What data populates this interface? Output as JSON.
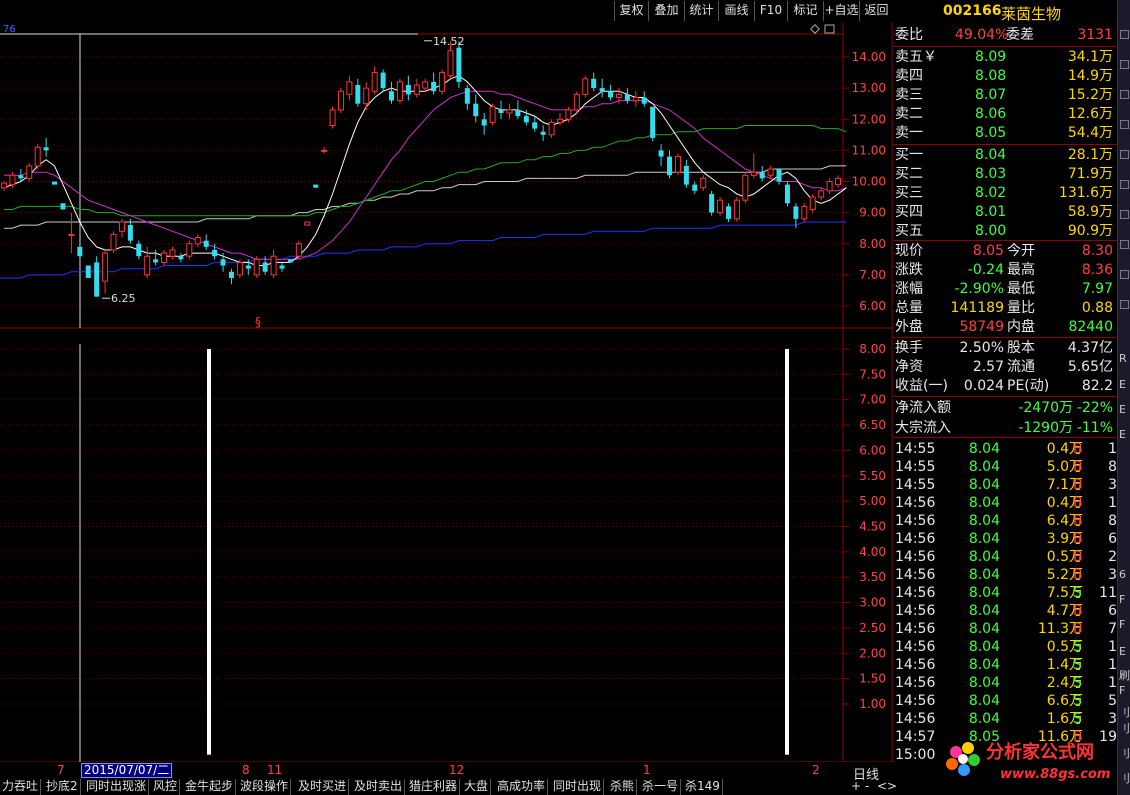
{
  "toolbar": {
    "buttons": [
      "复权",
      "叠加",
      "统计",
      "画线",
      "F10",
      "标记",
      "+自选",
      "返回"
    ]
  },
  "stock": {
    "code": "002166",
    "name": "莱茵生物"
  },
  "order_ratio": {
    "label1": "委比",
    "value1": "49.04%",
    "label2": "委差",
    "value2": "3131"
  },
  "asks": [
    {
      "label": "卖五￥",
      "price": "8.09",
      "volume": "34.1万"
    },
    {
      "label": "卖四",
      "price": "8.08",
      "volume": "14.9万"
    },
    {
      "label": "卖三",
      "price": "8.07",
      "volume": "15.2万"
    },
    {
      "label": "卖二",
      "price": "8.06",
      "volume": "12.6万"
    },
    {
      "label": "卖一",
      "price": "8.05",
      "volume": "54.4万"
    }
  ],
  "bids": [
    {
      "label": "买一",
      "price": "8.04",
      "volume": "28.1万"
    },
    {
      "label": "买二",
      "price": "8.03",
      "volume": "71.9万"
    },
    {
      "label": "买三",
      "price": "8.02",
      "volume": "131.6万"
    },
    {
      "label": "买四",
      "price": "8.01",
      "volume": "58.9万"
    },
    {
      "label": "买五",
      "price": "8.00",
      "volume": "90.9万"
    }
  ],
  "quote": [
    {
      "l1": "现价",
      "v1": "8.05",
      "c1": "#ff4040",
      "l2": "今开",
      "v2": "8.30",
      "c2": "#ff4040"
    },
    {
      "l1": "涨跌",
      "v1": "-0.24",
      "c1": "#40ff40",
      "l2": "最高",
      "v2": "8.36",
      "c2": "#ff4040"
    },
    {
      "l1": "涨幅",
      "v1": "-2.90%",
      "c1": "#40ff40",
      "l2": "最低",
      "v2": "7.97",
      "c2": "#40ff40"
    },
    {
      "l1": "总量",
      "v1": "141189",
      "c1": "#ffd700",
      "l2": "量比",
      "v2": "0.88",
      "c2": "#ffd700"
    },
    {
      "l1": "外盘",
      "v1": "58749",
      "c1": "#ff4040",
      "l2": "内盘",
      "v2": "82440",
      "c2": "#40ff40"
    }
  ],
  "fundamentals": [
    {
      "l1": "换手",
      "v1": "2.50%",
      "l2": "股本",
      "v2": "4.37亿"
    },
    {
      "l1": "净资",
      "v1": "2.57",
      "l2": "流通",
      "v2": "5.65亿"
    },
    {
      "l1": "收益(一)",
      "v1": "0.024",
      "l2": "PE(动)",
      "v2": "82.2"
    }
  ],
  "flows": [
    {
      "label": "净流入额",
      "value": "-2470万",
      "pct": "-22%"
    },
    {
      "label": "大宗流入",
      "value": "-1290万",
      "pct": "-11%"
    }
  ],
  "ticks": [
    {
      "time": "14:55",
      "price": "8.04",
      "vol": "0.4万",
      "side": "B",
      "n": "1"
    },
    {
      "time": "14:55",
      "price": "8.04",
      "vol": "5.0万",
      "side": "B",
      "n": "8"
    },
    {
      "time": "14:55",
      "price": "8.04",
      "vol": "7.1万",
      "side": "B",
      "n": "3"
    },
    {
      "time": "14:56",
      "price": "8.04",
      "vol": "0.4万",
      "side": "B",
      "n": "1"
    },
    {
      "time": "14:56",
      "price": "8.04",
      "vol": "6.4万",
      "side": "B",
      "n": "8"
    },
    {
      "time": "14:56",
      "price": "8.04",
      "vol": "3.9万",
      "side": "B",
      "n": "6"
    },
    {
      "time": "14:56",
      "price": "8.04",
      "vol": "0.5万",
      "side": "B",
      "n": "2"
    },
    {
      "time": "14:56",
      "price": "8.04",
      "vol": "5.2万",
      "side": "B",
      "n": "3"
    },
    {
      "time": "14:56",
      "price": "8.04",
      "vol": "7.5万",
      "side": "S",
      "n": "11"
    },
    {
      "time": "14:56",
      "price": "8.04",
      "vol": "4.7万",
      "side": "B",
      "n": "6"
    },
    {
      "time": "14:56",
      "price": "8.04",
      "vol": "11.3万",
      "side": "B",
      "n": "7"
    },
    {
      "time": "14:56",
      "price": "8.04",
      "vol": "0.5万",
      "side": "S",
      "n": "1"
    },
    {
      "time": "14:56",
      "price": "8.04",
      "vol": "1.4万",
      "side": "S",
      "n": "1"
    },
    {
      "time": "14:56",
      "price": "8.04",
      "vol": "2.4万",
      "side": "S",
      "n": "1"
    },
    {
      "time": "14:56",
      "price": "8.04",
      "vol": "6.6万",
      "side": "S",
      "n": "5"
    },
    {
      "time": "14:56",
      "price": "8.04",
      "vol": "1.6万",
      "side": "S",
      "n": "3"
    },
    {
      "time": "14:57",
      "price": "8.05",
      "vol": "11.6万",
      "side": "B",
      "n": "19"
    },
    {
      "time": "15:00",
      "price": "",
      "vol": "",
      "side": "",
      "n": ""
    }
  ],
  "bottom_tabs": [
    "力吞吐",
    "抄底2",
    "同时出现涨",
    "风控",
    "金牛起步",
    "波段操作",
    "及时买进",
    "及时卖出",
    "猎庄利器",
    "大盘",
    "高成功率",
    "同时出现",
    "杀熊",
    "杀一号",
    "杀149"
  ],
  "x_labels": [
    "7",
    "8",
    "11",
    "12",
    "1",
    "2"
  ],
  "selected_date": "2015/07/07/二",
  "period": "日线",
  "nav": [
    "+",
    "-",
    "<",
    ">"
  ],
  "corner_label": "76",
  "marker_symbol": "§",
  "watermark": {
    "title": "分析家公式网",
    "url": "www.88gs.com"
  },
  "side_strip_chars": [
    "R",
    "E",
    "E",
    "E",
    "6",
    "F",
    "F",
    "E",
    "刷",
    "F",
    "刂",
    "刂",
    "刂",
    "刂"
  ],
  "chart_data": {
    "type": "candlestick",
    "price_axis": {
      "ticks": [
        "14.00",
        "13.00",
        "12.00",
        "11.00",
        "10.00",
        "9.00",
        "8.00",
        "7.00",
        "6.00"
      ],
      "range": [
        5.6,
        14.8
      ]
    },
    "lower_axis": {
      "ticks": [
        "8.00",
        "7.50",
        "7.00",
        "6.50",
        "6.00",
        "5.50",
        "5.00",
        "4.50",
        "4.00",
        "3.50",
        "3.00",
        "2.50",
        "2.00",
        "1.50",
        "1.00"
      ],
      "range": [
        0.0,
        8.4
      ]
    },
    "annotations": [
      {
        "text": "14.52",
        "value": 14.52
      },
      {
        "text": "6.25",
        "value": 6.25
      }
    ],
    "candles": [
      [
        9.8,
        10.0,
        9.7,
        9.95
      ],
      [
        9.9,
        10.3,
        9.8,
        10.2
      ],
      [
        10.2,
        10.4,
        10.0,
        10.1
      ],
      [
        10.1,
        10.6,
        10.0,
        10.5
      ],
      [
        10.5,
        11.2,
        10.4,
        11.1
      ],
      [
        11.1,
        11.4,
        10.8,
        11.0
      ],
      [
        10.0,
        10.0,
        9.9,
        9.9
      ],
      [
        9.3,
        9.3,
        9.1,
        9.1
      ],
      [
        8.3,
        9.0,
        7.7,
        8.3
      ],
      [
        7.9,
        8.0,
        7.5,
        7.6
      ],
      [
        7.3,
        7.3,
        6.9,
        6.9
      ],
      [
        7.4,
        7.6,
        6.3,
        6.3
      ],
      [
        6.8,
        7.8,
        6.4,
        7.7
      ],
      [
        7.8,
        8.4,
        7.7,
        8.3
      ],
      [
        8.4,
        8.8,
        8.2,
        8.7
      ],
      [
        8.6,
        8.8,
        8.0,
        8.1
      ],
      [
        8.0,
        8.1,
        7.5,
        7.6
      ],
      [
        7.0,
        7.9,
        6.9,
        7.6
      ],
      [
        7.5,
        7.8,
        7.3,
        7.4
      ],
      [
        7.4,
        7.8,
        7.3,
        7.7
      ],
      [
        7.6,
        7.9,
        7.5,
        7.8
      ],
      [
        7.6,
        7.7,
        7.4,
        7.5
      ],
      [
        7.6,
        8.1,
        7.5,
        8.0
      ],
      [
        8.0,
        8.3,
        7.9,
        8.2
      ],
      [
        8.1,
        8.3,
        7.8,
        7.9
      ],
      [
        7.8,
        8.0,
        7.5,
        7.6
      ],
      [
        7.5,
        7.7,
        7.1,
        7.3
      ],
      [
        7.1,
        7.2,
        6.7,
        6.9
      ],
      [
        7.0,
        7.5,
        6.9,
        7.4
      ],
      [
        7.3,
        7.5,
        7.0,
        7.2
      ],
      [
        7.0,
        7.6,
        6.9,
        7.5
      ],
      [
        7.4,
        7.6,
        7.0,
        7.1
      ],
      [
        7.0,
        7.8,
        6.9,
        7.6
      ],
      [
        7.3,
        7.4,
        7.1,
        7.2
      ],
      [
        7.5,
        7.5,
        7.4,
        7.4
      ],
      [
        7.6,
        8.1,
        7.5,
        8.0
      ],
      [
        8.6,
        8.7,
        8.6,
        8.7
      ],
      [
        9.9,
        9.9,
        9.8,
        9.8
      ],
      [
        11.0,
        11.1,
        10.9,
        11.0
      ],
      [
        11.8,
        12.4,
        11.7,
        12.3
      ],
      [
        12.3,
        13.0,
        12.2,
        12.9
      ],
      [
        12.8,
        13.4,
        12.6,
        13.2
      ],
      [
        13.1,
        13.3,
        12.4,
        12.5
      ],
      [
        12.5,
        13.2,
        12.3,
        13.0
      ],
      [
        12.9,
        13.7,
        12.8,
        13.5
      ],
      [
        13.5,
        13.6,
        12.9,
        13.0
      ],
      [
        12.9,
        13.2,
        12.5,
        12.6
      ],
      [
        12.6,
        13.3,
        12.5,
        13.2
      ],
      [
        13.1,
        13.4,
        12.6,
        12.8
      ],
      [
        12.8,
        13.3,
        12.7,
        13.1
      ],
      [
        13.0,
        13.3,
        12.9,
        13.2
      ],
      [
        13.2,
        13.5,
        12.8,
        12.9
      ],
      [
        12.9,
        13.6,
        12.8,
        13.5
      ],
      [
        13.4,
        14.5,
        13.3,
        14.2
      ],
      [
        14.3,
        14.5,
        13.0,
        13.2
      ],
      [
        13.0,
        13.1,
        12.3,
        12.5
      ],
      [
        12.5,
        12.8,
        11.9,
        12.1
      ],
      [
        12.0,
        12.2,
        11.5,
        11.8
      ],
      [
        11.9,
        12.5,
        11.8,
        12.4
      ],
      [
        12.3,
        12.6,
        12.0,
        12.2
      ],
      [
        12.2,
        12.5,
        12.0,
        12.3
      ],
      [
        12.3,
        12.6,
        12.0,
        12.1
      ],
      [
        12.1,
        12.3,
        11.8,
        11.9
      ],
      [
        11.9,
        12.1,
        11.6,
        11.7
      ],
      [
        11.6,
        11.8,
        11.3,
        11.5
      ],
      [
        11.5,
        12.0,
        11.4,
        11.9
      ],
      [
        11.9,
        12.2,
        11.8,
        12.0
      ],
      [
        12.0,
        12.4,
        11.9,
        12.3
      ],
      [
        12.3,
        12.9,
        12.2,
        12.8
      ],
      [
        12.8,
        13.4,
        12.7,
        13.3
      ],
      [
        13.3,
        13.5,
        12.9,
        13.0
      ],
      [
        13.0,
        13.3,
        12.7,
        12.9
      ],
      [
        12.9,
        13.1,
        12.6,
        12.7
      ],
      [
        12.7,
        13.0,
        12.5,
        12.8
      ],
      [
        12.8,
        13.0,
        12.5,
        12.6
      ],
      [
        12.6,
        12.9,
        12.4,
        12.7
      ],
      [
        12.7,
        12.9,
        12.4,
        12.5
      ],
      [
        12.4,
        12.4,
        11.3,
        11.4
      ],
      [
        11.0,
        11.2,
        10.5,
        10.8
      ],
      [
        10.8,
        11.0,
        10.1,
        10.2
      ],
      [
        10.3,
        10.9,
        10.2,
        10.8
      ],
      [
        10.5,
        10.7,
        9.8,
        9.9
      ],
      [
        9.9,
        10.0,
        9.6,
        9.7
      ],
      [
        9.8,
        10.2,
        9.7,
        10.1
      ],
      [
        9.6,
        9.7,
        8.9,
        9.0
      ],
      [
        9.0,
        9.5,
        8.9,
        9.4
      ],
      [
        9.2,
        9.3,
        8.7,
        8.8
      ],
      [
        8.8,
        9.5,
        8.7,
        9.4
      ],
      [
        9.4,
        10.3,
        9.3,
        10.2
      ],
      [
        10.2,
        10.9,
        10.1,
        10.3
      ],
      [
        10.3,
        10.5,
        10.0,
        10.1
      ],
      [
        10.2,
        10.5,
        10.1,
        10.4
      ],
      [
        10.4,
        10.4,
        9.9,
        10.0
      ],
      [
        9.9,
        10.0,
        9.2,
        9.3
      ],
      [
        9.2,
        9.3,
        8.5,
        8.8
      ],
      [
        8.8,
        9.3,
        8.7,
        9.2
      ],
      [
        9.1,
        9.6,
        9.0,
        9.5
      ],
      [
        9.5,
        9.8,
        9.4,
        9.7
      ],
      [
        9.7,
        10.1,
        9.6,
        10.0
      ],
      [
        9.9,
        10.2,
        9.8,
        10.1
      ]
    ],
    "ma_white": [
      9.8,
      9.9,
      10.0,
      10.2,
      10.5,
      10.7,
      10.5,
      9.9,
      9.3,
      8.7,
      8.2,
      7.9,
      7.8,
      7.8,
      7.9,
      7.9,
      7.8,
      7.7,
      7.7,
      7.6,
      7.6,
      7.6,
      7.7,
      7.7,
      7.7,
      7.7,
      7.6,
      7.5,
      7.4,
      7.4,
      7.3,
      7.3,
      7.4,
      7.4,
      7.4,
      7.6,
      7.9,
      8.3,
      8.9,
      9.6,
      10.4,
      11.2,
      11.9,
      12.4,
      12.7,
      12.9,
      13.0,
      12.9,
      12.9,
      12.9,
      12.9,
      13.0,
      13.1,
      13.3,
      13.4,
      13.2,
      12.9,
      12.6,
      12.4,
      12.3,
      12.3,
      12.3,
      12.2,
      12.1,
      11.9,
      11.8,
      11.9,
      12.0,
      12.2,
      12.5,
      12.7,
      12.9,
      12.9,
      12.9,
      12.8,
      12.7,
      12.7,
      12.5,
      12.2,
      11.8,
      11.4,
      11.0,
      10.6,
      10.3,
      10.1,
      9.9,
      9.8,
      9.6,
      9.5,
      9.6,
      9.8,
      10.0,
      10.2,
      10.3,
      10.1,
      9.7,
      9.4,
      9.3,
      9.4,
      9.6,
      9.8
    ],
    "ma_magenta": [
      10.2,
      10.2,
      10.2,
      10.3,
      10.3,
      10.3,
      10.2,
      10.0,
      9.8,
      9.6,
      9.4,
      9.3,
      9.2,
      9.1,
      9.0,
      8.9,
      8.8,
      8.7,
      8.6,
      8.5,
      8.4,
      8.3,
      8.2,
      8.1,
      8.0,
      7.9,
      7.8,
      7.7,
      7.7,
      7.6,
      7.5,
      7.5,
      7.5,
      7.5,
      7.5,
      7.5,
      7.6,
      7.7,
      7.9,
      8.1,
      8.4,
      8.7,
      9.1,
      9.5,
      9.9,
      10.3,
      10.7,
      11.0,
      11.4,
      11.7,
      12.0,
      12.3,
      12.5,
      12.7,
      12.8,
      12.9,
      12.9,
      12.9,
      12.9,
      12.8,
      12.8,
      12.7,
      12.6,
      12.5,
      12.4,
      12.3,
      12.3,
      12.3,
      12.3,
      12.4,
      12.4,
      12.5,
      12.5,
      12.6,
      12.6,
      12.6,
      12.6,
      12.5,
      12.4,
      12.3,
      12.1,
      11.9,
      11.7,
      11.4,
      11.2,
      11.0,
      10.8,
      10.6,
      10.4,
      10.3,
      10.2,
      10.1,
      10.0,
      10.0,
      10.0,
      9.9,
      9.8,
      9.8,
      9.7,
      9.7,
      9.8
    ],
    "ma_green": [
      9.1,
      9.1,
      9.2,
      9.2,
      9.2,
      9.2,
      9.2,
      9.2,
      9.2,
      9.1,
      9.1,
      9.0,
      9.0,
      9.0,
      8.9,
      8.9,
      8.9,
      8.9,
      8.9,
      8.9,
      8.9,
      8.9,
      8.9,
      8.9,
      8.9,
      8.9,
      8.9,
      8.9,
      8.9,
      8.9,
      8.9,
      8.9,
      8.9,
      8.9,
      8.9,
      8.9,
      8.9,
      9.0,
      9.0,
      9.1,
      9.2,
      9.2,
      9.3,
      9.4,
      9.5,
      9.6,
      9.7,
      9.7,
      9.8,
      9.9,
      10.0,
      10.0,
      10.1,
      10.2,
      10.3,
      10.3,
      10.4,
      10.4,
      10.5,
      10.6,
      10.6,
      10.6,
      10.7,
      10.7,
      10.8,
      10.8,
      10.9,
      10.9,
      11.0,
      11.0,
      11.1,
      11.1,
      11.2,
      11.3,
      11.3,
      11.4,
      11.4,
      11.5,
      11.5,
      11.5,
      11.6,
      11.6,
      11.6,
      11.7,
      11.7,
      11.7,
      11.7,
      11.7,
      11.8,
      11.8,
      11.8,
      11.8,
      11.8,
      11.8,
      11.8,
      11.8,
      11.8,
      11.7,
      11.7,
      11.7,
      11.6
    ],
    "ma_gray": [
      8.5,
      8.5,
      8.6,
      8.6,
      8.6,
      8.7,
      8.7,
      8.7,
      8.7,
      8.7,
      8.7,
      8.7,
      8.7,
      8.7,
      8.7,
      8.7,
      8.7,
      8.7,
      8.7,
      8.7,
      8.7,
      8.7,
      8.7,
      8.7,
      8.8,
      8.8,
      8.8,
      8.8,
      8.8,
      8.8,
      8.9,
      8.9,
      8.9,
      8.9,
      8.9,
      9.0,
      9.0,
      9.1,
      9.1,
      9.2,
      9.2,
      9.3,
      9.3,
      9.4,
      9.4,
      9.5,
      9.5,
      9.6,
      9.6,
      9.7,
      9.7,
      9.7,
      9.8,
      9.8,
      9.9,
      9.9,
      9.9,
      10.0,
      10.0,
      10.0,
      10.0,
      10.0,
      10.1,
      10.1,
      10.1,
      10.1,
      10.1,
      10.1,
      10.1,
      10.2,
      10.2,
      10.2,
      10.2,
      10.2,
      10.2,
      10.3,
      10.3,
      10.3,
      10.3,
      10.3,
      10.3,
      10.3,
      10.3,
      10.3,
      10.3,
      10.3,
      10.3,
      10.3,
      10.3,
      10.3,
      10.3,
      10.4,
      10.4,
      10.4,
      10.4,
      10.4,
      10.4,
      10.4,
      10.5,
      10.5,
      10.5
    ],
    "ma_blue": [
      6.9,
      6.9,
      6.9,
      7.0,
      7.0,
      7.0,
      7.0,
      7.0,
      7.1,
      7.1,
      7.1,
      7.1,
      7.1,
      7.1,
      7.2,
      7.2,
      7.2,
      7.2,
      7.2,
      7.3,
      7.3,
      7.3,
      7.3,
      7.3,
      7.3,
      7.4,
      7.4,
      7.4,
      7.4,
      7.4,
      7.5,
      7.5,
      7.5,
      7.5,
      7.6,
      7.6,
      7.6,
      7.6,
      7.7,
      7.7,
      7.7,
      7.7,
      7.8,
      7.8,
      7.8,
      7.8,
      7.9,
      7.9,
      7.9,
      7.9,
      8.0,
      8.0,
      8.0,
      8.0,
      8.1,
      8.1,
      8.1,
      8.1,
      8.1,
      8.2,
      8.2,
      8.2,
      8.2,
      8.2,
      8.3,
      8.3,
      8.3,
      8.3,
      8.3,
      8.3,
      8.4,
      8.4,
      8.4,
      8.4,
      8.4,
      8.4,
      8.4,
      8.5,
      8.5,
      8.5,
      8.5,
      8.5,
      8.5,
      8.5,
      8.5,
      8.6,
      8.6,
      8.6,
      8.6,
      8.6,
      8.6,
      8.6,
      8.6,
      8.6,
      8.6,
      8.7,
      8.7,
      8.7,
      8.7,
      8.7,
      8.7
    ],
    "lower_bars": [
      {
        "candle_index": 25,
        "value": 8.0
      },
      {
        "candle_index": 95,
        "value": 8.0
      }
    ]
  }
}
